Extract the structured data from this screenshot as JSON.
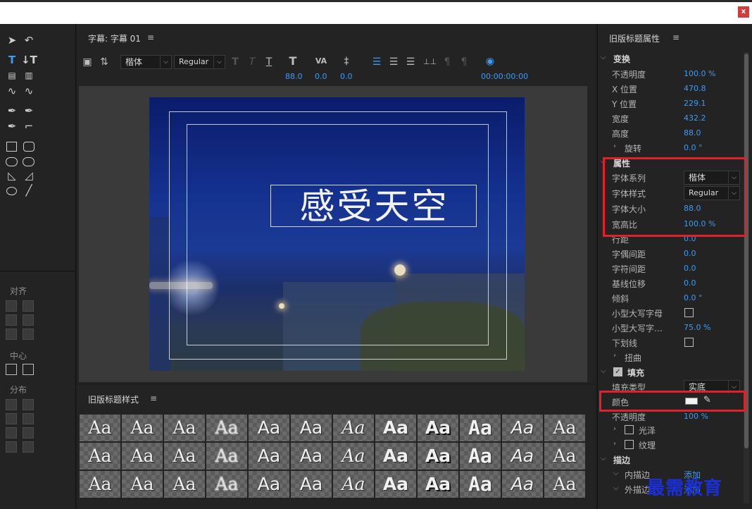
{
  "window": {
    "close_label": "x"
  },
  "main": {
    "title": "字幕: 字幕 01",
    "font_family": "楷体",
    "font_style": "Regular",
    "toolbar_values": {
      "size": "88.0",
      "kerning": "0.0",
      "leading": "0.0",
      "timecode": "00:00:00:00"
    },
    "title_text": "感受天空"
  },
  "tools": {
    "align_label": "对齐",
    "center_label": "中心",
    "distribute_label": "分布"
  },
  "styles": {
    "title": "旧版标题样式",
    "swatch_text": "Aa",
    "count": 36
  },
  "props": {
    "title": "旧版标题属性",
    "transform": {
      "label": "变换",
      "opacity_label": "不透明度",
      "opacity": "100.0 %",
      "x_label": "X 位置",
      "x": "470.8",
      "y_label": "Y 位置",
      "y": "229.1",
      "width_label": "宽度",
      "width": "432.2",
      "height_label": "高度",
      "height": "88.0",
      "rotation_label": "旋转",
      "rotation": "0.0 °"
    },
    "attributes": {
      "label": "属性",
      "font_family_label": "字体系列",
      "font_family": "楷体",
      "font_style_label": "字体样式",
      "font_style": "Regular",
      "font_size_label": "字体大小",
      "font_size": "88.0",
      "aspect_label": "宽高比",
      "aspect": "100.0 %",
      "leading_label": "行距",
      "leading": "0.0",
      "kerning_label": "字偶间距",
      "kerning": "0.0",
      "tracking_label": "字符间距",
      "tracking": "0.0",
      "baseline_label": "基线位移",
      "baseline": "0.0",
      "slant_label": "倾斜",
      "slant": "0.0 °",
      "smallcaps_label": "小型大写字母",
      "smallcaps_size_label": "小型大写字…",
      "smallcaps_size": "75.0 %",
      "underline_label": "下划线",
      "distort_label": "扭曲"
    },
    "fill": {
      "label": "填充",
      "type_label": "填充类型",
      "type": "实底",
      "color_label": "颜色",
      "color": "#f2f2f2",
      "opacity_label": "不透明度",
      "opacity": "100 %",
      "sheen_label": "光泽",
      "texture_label": "纹理"
    },
    "stroke": {
      "label": "描边",
      "inner_label": "内描边",
      "inner_add": "添加",
      "outer_label": "外描边",
      "outer_add": "添加"
    }
  },
  "watermark": "最需教育",
  "colors": {
    "accent": "#3d9bf2",
    "highlight": "#e0202a"
  }
}
